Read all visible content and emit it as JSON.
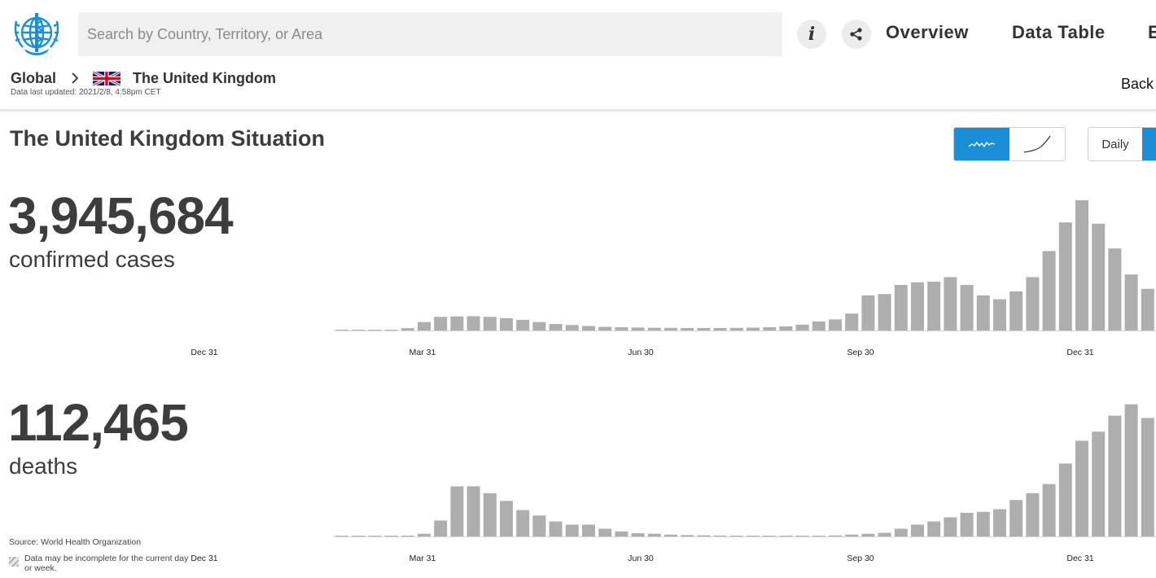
{
  "header": {
    "logo_icon": "who-emblem-icon",
    "search_placeholder": "Search by Country, Territory, or Area",
    "info_icon": "info-icon",
    "share_icon": "share-icon",
    "nav": [
      "Overview",
      "Data Table",
      "E"
    ]
  },
  "breadcrumb": {
    "global": "Global",
    "country": "The United Kingdom",
    "flag_icon": "uk-flag-icon",
    "updated": "Data last updated: 2021/2/8, 4:58pm CET",
    "back": "Back"
  },
  "situation": {
    "title": "The United Kingdom Situation",
    "chart_toggle_icons": [
      "daily-bars-icon",
      "cumulative-curve-icon"
    ],
    "period_toggle": {
      "daily": "Daily"
    }
  },
  "cases": {
    "number": "3,945,684",
    "label": "confirmed cases"
  },
  "deaths": {
    "number": "112,465",
    "label": "deaths"
  },
  "source": "Source: World Health Organization",
  "disclaimer": "Data may be incomplete for the current day or week.",
  "colors": {
    "accent": "#1a8fd8",
    "bar": "#aeaeae",
    "text": "#3d3d3d"
  },
  "chart_data": [
    {
      "type": "bar",
      "series_of": "confirmed cases (weekly)",
      "x_ticks": [
        "Dec 31",
        "Mar 31",
        "Jun 30",
        "Sep 30",
        "Dec 31"
      ],
      "values": [
        0,
        0,
        0,
        300,
        1800,
        6500,
        10500,
        10800,
        11000,
        10500,
        9500,
        8200,
        6500,
        5000,
        4200,
        3500,
        2800,
        2500,
        2300,
        2100,
        2000,
        1900,
        1900,
        1900,
        2000,
        2200,
        2500,
        3200,
        4500,
        7000,
        8500,
        13000,
        27000,
        28000,
        35000,
        37000,
        37500,
        41000,
        35000,
        27000,
        24000,
        30000,
        41000,
        61000,
        83000,
        100000,
        82000,
        63000,
        43000,
        32000
      ],
      "ylim": [
        0,
        105000
      ]
    },
    {
      "type": "bar",
      "series_of": "deaths (weekly)",
      "x_ticks": [
        "Dec 31",
        "Mar 31",
        "Jun 30",
        "Sep 30",
        "Dec 31"
      ],
      "values": [
        0,
        0,
        0,
        0,
        0,
        60,
        350,
        1100,
        1100,
        950,
        780,
        580,
        460,
        330,
        260,
        260,
        170,
        110,
        70,
        60,
        40,
        30,
        25,
        20,
        15,
        12,
        12,
        12,
        12,
        15,
        22,
        40,
        60,
        80,
        170,
        260,
        330,
        420,
        520,
        540,
        600,
        800,
        950,
        1150,
        1600,
        2100,
        2300,
        2650,
        2900,
        2600
      ],
      "ylim": [
        0,
        3000
      ]
    }
  ]
}
